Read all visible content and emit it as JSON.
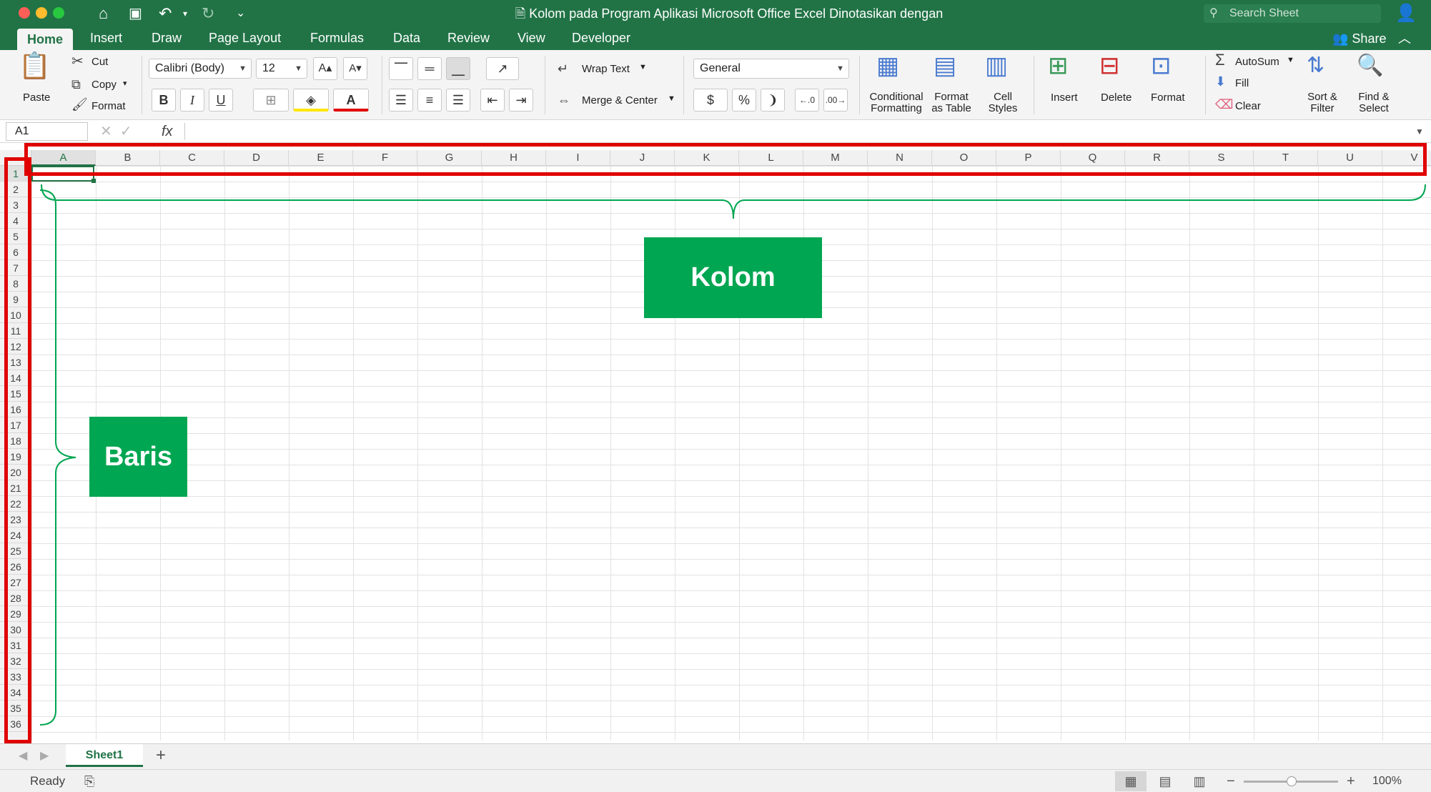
{
  "window": {
    "title": "Kolom pada Program Aplikasi Microsoft Office Excel Dinotasikan dengan",
    "search_placeholder": "Search Sheet",
    "traffic_lights": {
      "close": "#ff5f57",
      "minimize": "#febc2e",
      "zoom": "#28c840"
    }
  },
  "quick_access": {
    "home_icon": "⌂",
    "save_icon": "💾",
    "undo_icon": "↶",
    "redo_icon": "↻",
    "more_icon": "⌄"
  },
  "tabs": [
    "Home",
    "Insert",
    "Draw",
    "Page Layout",
    "Formulas",
    "Data",
    "Review",
    "View",
    "Developer"
  ],
  "active_tab": "Home",
  "share_label": "Share",
  "ribbon": {
    "paste": "Paste",
    "cut": "Cut",
    "copy": "Copy",
    "format_painter": "Format",
    "font_name": "Calibri (Body)",
    "font_size": "12",
    "bold": "B",
    "italic": "I",
    "underline": "U",
    "wrap_text": "Wrap Text",
    "merge_center": "Merge & Center",
    "number_format": "General",
    "currency": "$",
    "percent": "%",
    "comma": "❩",
    "conditional_formatting": [
      "Conditional",
      "Formatting"
    ],
    "format_as_table": [
      "Format",
      "as Table"
    ],
    "cell_styles": [
      "Cell",
      "Styles"
    ],
    "insert": "Insert",
    "delete": "Delete",
    "format": "Format",
    "autosum": "AutoSum",
    "fill": "Fill",
    "clear": "Clear",
    "sort_filter": [
      "Sort &",
      "Filter"
    ],
    "find_select": [
      "Find &",
      "Select"
    ]
  },
  "formula_bar": {
    "name_box": "A1",
    "fx": "fx",
    "value": ""
  },
  "columns": [
    "A",
    "B",
    "C",
    "D",
    "E",
    "F",
    "G",
    "H",
    "I",
    "J",
    "K",
    "L",
    "M",
    "N",
    "O",
    "P",
    "Q",
    "R",
    "S",
    "T",
    "U",
    "V"
  ],
  "rows": [
    "1",
    "2",
    "3",
    "4",
    "5",
    "6",
    "7",
    "8",
    "9",
    "10",
    "11",
    "12",
    "13",
    "14",
    "15",
    "16",
    "17",
    "18",
    "19",
    "20",
    "21",
    "22",
    "23",
    "24",
    "25",
    "26",
    "27",
    "28",
    "29",
    "30",
    "31",
    "32",
    "33",
    "34",
    "35",
    "36"
  ],
  "selected_cell": {
    "column": "A",
    "row": "1"
  },
  "annotations": {
    "column_label": "Kolom",
    "row_label": "Baris",
    "box_color": "#e00000",
    "callout_color": "#00a651"
  },
  "sheet_tabs": [
    "Sheet1"
  ],
  "status": {
    "ready": "Ready",
    "zoom": "100%"
  },
  "accent": "#217346"
}
